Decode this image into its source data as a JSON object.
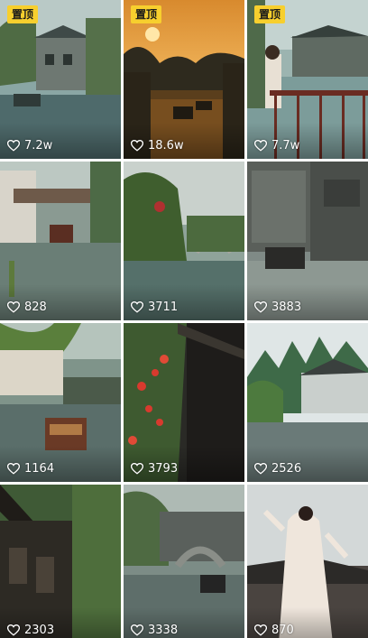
{
  "badges": {
    "pinned": "置顶"
  },
  "videos": [
    {
      "likes": "7.2w",
      "pinned": true
    },
    {
      "likes": "18.6w",
      "pinned": true
    },
    {
      "likes": "7.7w",
      "pinned": true
    },
    {
      "likes": "828",
      "pinned": false
    },
    {
      "likes": "3711",
      "pinned": false
    },
    {
      "likes": "3883",
      "pinned": false
    },
    {
      "likes": "1164",
      "pinned": false
    },
    {
      "likes": "3793",
      "pinned": false
    },
    {
      "likes": "2526",
      "pinned": false
    },
    {
      "likes": "2303",
      "pinned": false
    },
    {
      "likes": "3338",
      "pinned": false
    },
    {
      "likes": "870",
      "pinned": false
    }
  ],
  "icons": {
    "like": "heart-outline-icon"
  },
  "colors": {
    "pinned_badge": "#f7cf2e"
  }
}
